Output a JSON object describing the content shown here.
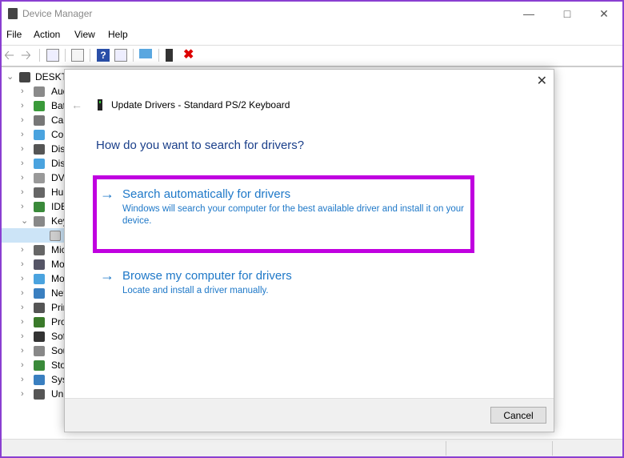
{
  "window": {
    "title": "Device Manager",
    "controls": [
      "minimize",
      "maximize",
      "close"
    ]
  },
  "menu": [
    "File",
    "Action",
    "View",
    "Help"
  ],
  "toolbar": [
    "back-icon",
    "forward-icon",
    "properties-icon",
    "show-hidden-icon",
    "help-icon",
    "action-view-icon",
    "scan-hardware-icon",
    "update-driver-icon",
    "uninstall-icon"
  ],
  "tree": {
    "root": "DESKTO",
    "items": [
      {
        "label": "Aud",
        "expanded": false
      },
      {
        "label": "Bat",
        "expanded": false
      },
      {
        "label": "Car",
        "expanded": false
      },
      {
        "label": "Cor",
        "expanded": false
      },
      {
        "label": "Disk",
        "expanded": false
      },
      {
        "label": "Disp",
        "expanded": false
      },
      {
        "label": "DVD",
        "expanded": false
      },
      {
        "label": "Hur",
        "expanded": false
      },
      {
        "label": "IDE",
        "expanded": false
      },
      {
        "label": "Key",
        "expanded": true
      },
      {
        "label": "",
        "child": true
      },
      {
        "label": "Mic",
        "expanded": false
      },
      {
        "label": "Mo",
        "expanded": false
      },
      {
        "label": "Mo",
        "expanded": false
      },
      {
        "label": "Net",
        "expanded": false
      },
      {
        "label": "Prir",
        "expanded": false
      },
      {
        "label": "Pro",
        "expanded": false
      },
      {
        "label": "Sof",
        "expanded": false
      },
      {
        "label": "Sou",
        "expanded": false
      },
      {
        "label": "Sto",
        "expanded": false
      },
      {
        "label": "Sys",
        "expanded": false
      },
      {
        "label": "Uni",
        "expanded": false
      }
    ]
  },
  "dialog": {
    "title": "Update Drivers - Standard PS/2 Keyboard",
    "question": "How do you want to search for drivers?",
    "option1": {
      "heading": "Search automatically for drivers",
      "desc": "Windows will search your computer for the best available driver and install it on your device."
    },
    "option2": {
      "heading": "Browse my computer for drivers",
      "desc": "Locate and install a driver manually."
    },
    "cancel": "Cancel",
    "highlight_color": "#c000e0"
  }
}
